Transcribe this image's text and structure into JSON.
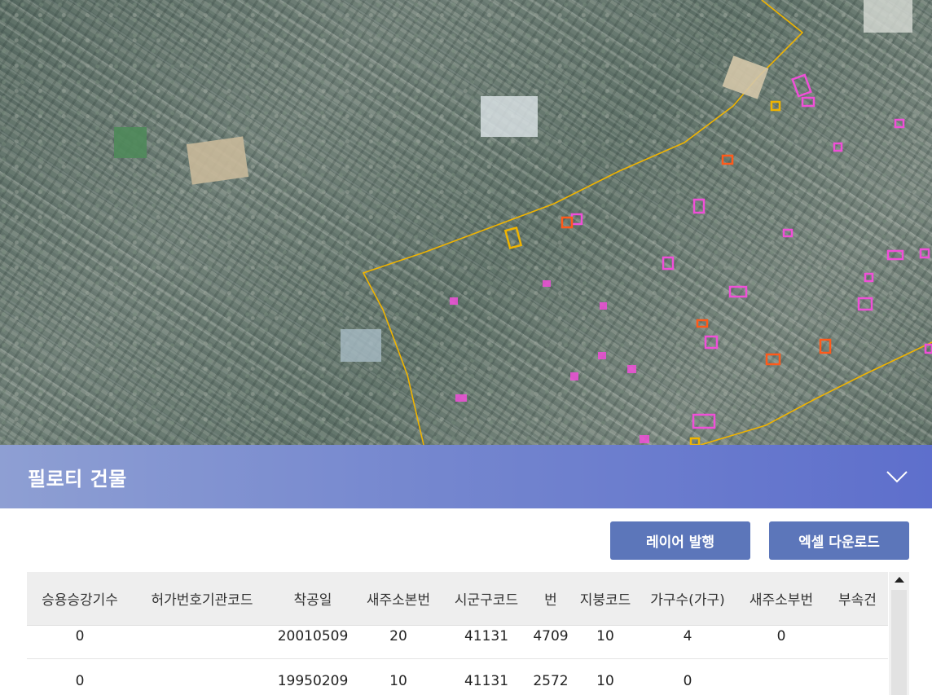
{
  "panel": {
    "title": "필로티 건물",
    "collapse_icon": "chevron-down-icon"
  },
  "toolbar": {
    "layer_button": "레이어 발행",
    "excel_button": "엑셀 다운로드"
  },
  "table": {
    "columns": [
      "승용승강기수",
      "허가번호기관코드",
      "착공일",
      "새주소본번",
      "시군구코드",
      "번",
      "지붕코드",
      "가구수(가구)",
      "새주소부번",
      "부속건"
    ],
    "rows": [
      [
        "0",
        "",
        "20010509",
        "20",
        "41131",
        "4709",
        "10",
        "4",
        "0",
        ""
      ],
      [
        "0",
        "",
        "19950209",
        "10",
        "41131",
        "2572",
        "10",
        "0",
        "",
        ""
      ]
    ]
  },
  "colors": {
    "header_gradient_start": "#8e9fd3",
    "header_gradient_end": "#5e6fcc",
    "button": "#5c76ba",
    "boundary": "#f0b400",
    "marker_pink": "#f04fd8",
    "marker_orange": "#ff5a1a"
  }
}
